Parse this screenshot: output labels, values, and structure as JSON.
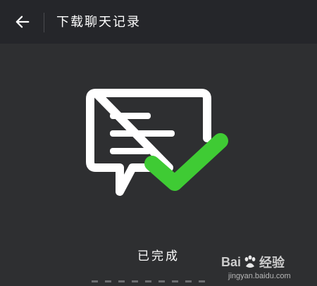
{
  "header": {
    "back_icon": "arrow-left-icon",
    "title": "下载聊天记录"
  },
  "illustration": {
    "icon": "chat-message-check-icon",
    "bubble_color": "#ffffff",
    "check_color": "#3fcb34"
  },
  "status": {
    "text": "已完成"
  },
  "watermark": {
    "brand_prefix": "Bai",
    "brand_suffix": "经验",
    "url": "jingyan.baidu.com"
  },
  "colors": {
    "background": "#2e2f31",
    "header_background": "#25262a",
    "text": "#ffffff"
  }
}
